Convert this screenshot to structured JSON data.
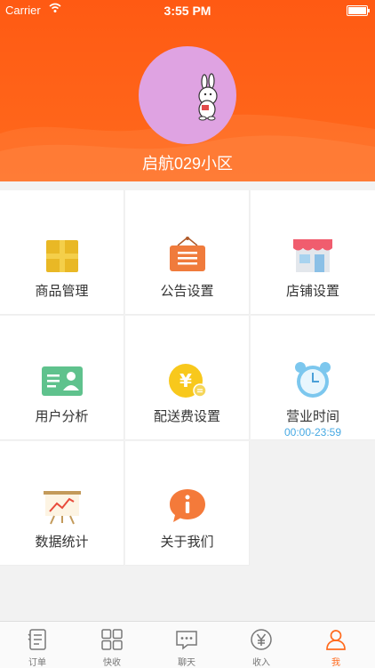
{
  "status_bar": {
    "carrier": "Carrier",
    "time": "3:55 PM"
  },
  "profile": {
    "store_name": "启航029小区"
  },
  "menu": [
    {
      "label": "商品管理"
    },
    {
      "label": "公告设置"
    },
    {
      "label": "店铺设置"
    },
    {
      "label": "用户分析"
    },
    {
      "label": "配送费设置"
    },
    {
      "label": "营业时间",
      "sub": "00:00-23:59"
    },
    {
      "label": "数据统计"
    },
    {
      "label": "关于我们"
    }
  ],
  "tabs": [
    {
      "label": "订单",
      "icon": "order-icon"
    },
    {
      "label": "快收",
      "icon": "grid-icon"
    },
    {
      "label": "聊天",
      "icon": "chat-icon"
    },
    {
      "label": "收入",
      "icon": "yen-icon"
    },
    {
      "label": "我",
      "icon": "user-icon",
      "active": true
    }
  ],
  "colors": {
    "brand": "#ff5a13",
    "active_tab": "#ff6a1d",
    "subtext": "#46a9e3"
  }
}
